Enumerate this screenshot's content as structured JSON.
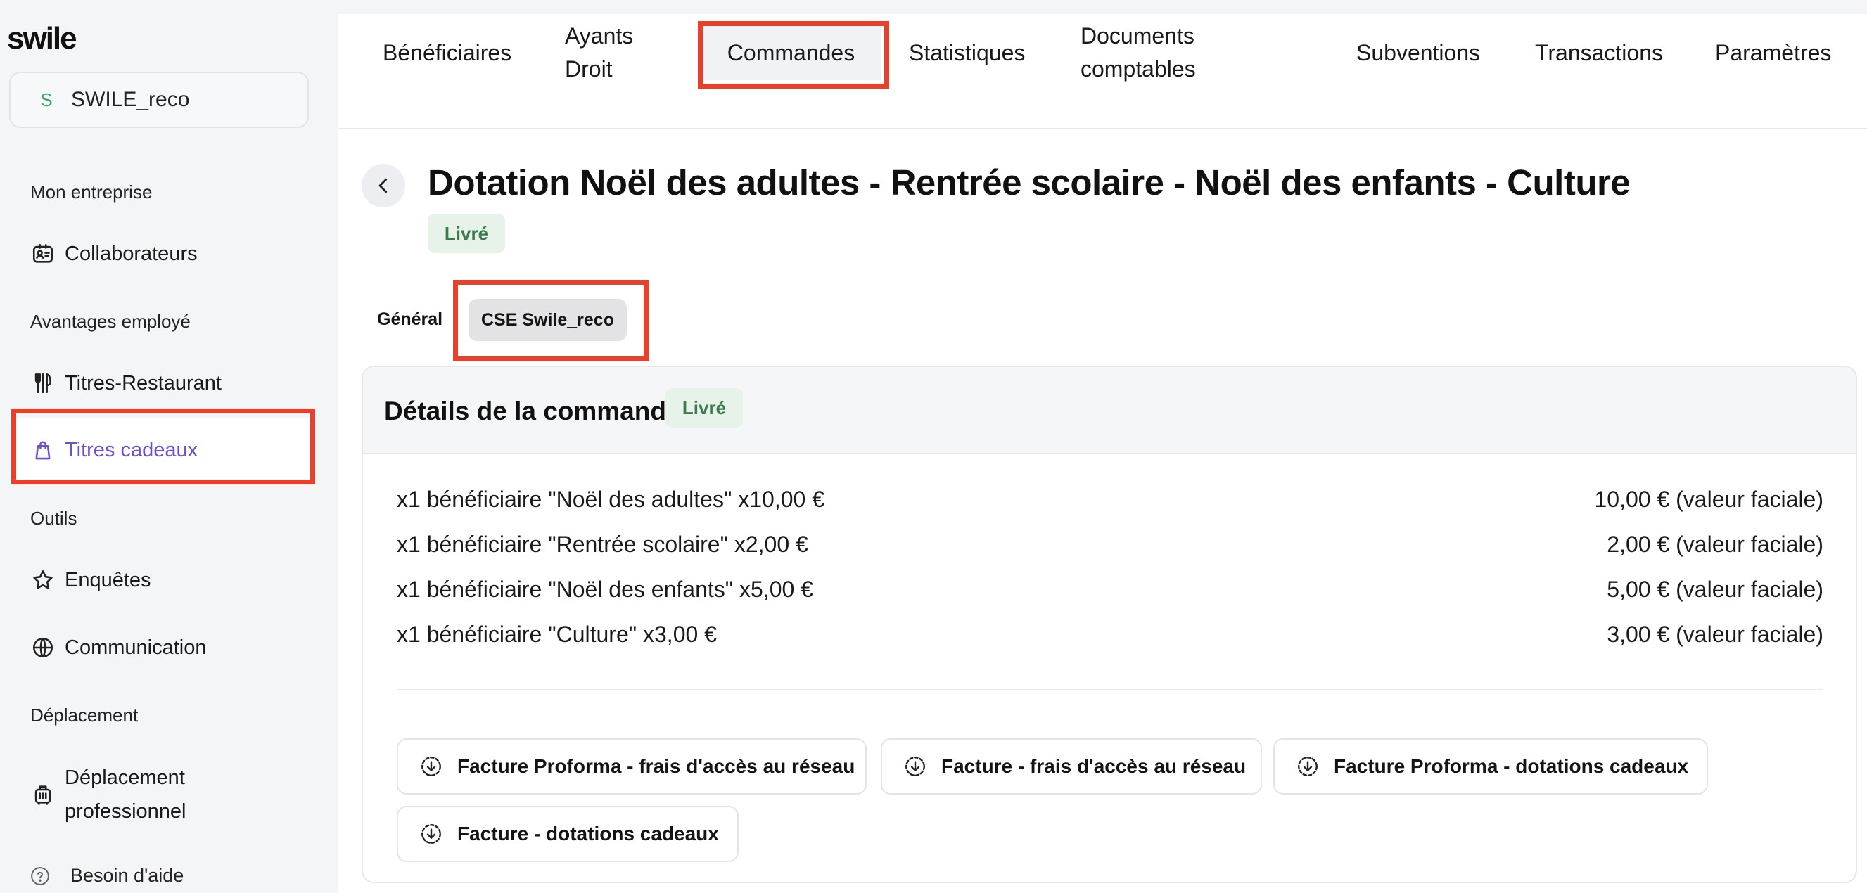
{
  "app": {
    "logo": "swile"
  },
  "org": {
    "initial": "S",
    "name": "SWILE_reco"
  },
  "sidebar": {
    "sections": [
      "Mon entreprise",
      "Avantages employé",
      "Outils",
      "Déplacement"
    ],
    "items": [
      {
        "label": "Collaborateurs",
        "icon": "id-card-icon"
      },
      {
        "label": "Titres-Restaurant",
        "icon": "fork-knife-icon"
      },
      {
        "label": "Titres cadeaux",
        "icon": "shopping-bag-icon",
        "active": true
      },
      {
        "label": "Enquêtes",
        "icon": "star-icon"
      },
      {
        "label": "Communication",
        "icon": "globe-icon"
      },
      {
        "label_line1": "Déplacement",
        "label_line2": "professionnel",
        "icon": "luggage-icon"
      }
    ],
    "help": "Besoin d'aide"
  },
  "topnav": {
    "tabs": [
      {
        "label": "Bénéficiaires"
      },
      {
        "line1": "Ayants",
        "line2": "Droit"
      },
      {
        "label": "Commandes",
        "active": true
      },
      {
        "label": "Statistiques"
      },
      {
        "line1": "Documents",
        "line2": "comptables"
      },
      {
        "label": "Subventions"
      },
      {
        "label": "Transactions"
      },
      {
        "label": "Paramètres"
      }
    ]
  },
  "order": {
    "title": "Dotation Noël des adultes - Rentrée scolaire - Noël des enfants - Culture",
    "status": "Livré",
    "tabs": [
      {
        "label": "Général"
      },
      {
        "label": "CSE Swile_reco",
        "active": true
      }
    ],
    "details": {
      "title": "Détails de la commande",
      "status": "Livré",
      "lines": [
        {
          "desc": "x1 bénéficiaire \"Noël des adultes\" x10,00 €",
          "amount": "10,00 € (valeur faciale)"
        },
        {
          "desc": "x1 bénéficiaire \"Rentrée scolaire\" x2,00 €",
          "amount": "2,00 € (valeur faciale)"
        },
        {
          "desc": "x1 bénéficiaire \"Noël des enfants\" x5,00 €",
          "amount": "5,00 € (valeur faciale)"
        },
        {
          "desc": "x1 bénéficiaire \"Culture\" x3,00 €",
          "amount": "3,00 € (valeur faciale)"
        }
      ],
      "downloads": [
        {
          "label": "Facture Proforma - frais d'accès au réseau",
          "icon": "download-icon"
        },
        {
          "label": "Facture - frais d'accès au réseau",
          "icon": "download-icon"
        },
        {
          "label": "Facture Proforma - dotations cadeaux",
          "icon": "download-icon"
        },
        {
          "label": "Facture - dotations cadeaux",
          "icon": "download-icon"
        }
      ]
    }
  },
  "colors": {
    "accent": "#6e4fcf",
    "highlight": "#e8402b",
    "success_bg": "#e7f2e9",
    "success_text": "#3b7a4f"
  }
}
